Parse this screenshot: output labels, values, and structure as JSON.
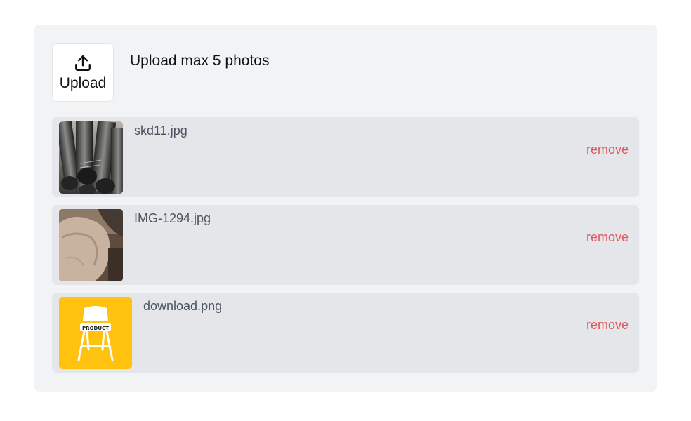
{
  "uploader": {
    "button_label": "Upload",
    "hint": "Upload max 5 photos"
  },
  "files": [
    {
      "name": "skd11.jpg",
      "remove_label": "remove"
    },
    {
      "name": "IMG-1294.jpg",
      "remove_label": "remove"
    },
    {
      "name": "download.png",
      "remove_label": "remove",
      "thumb_text": "PRODUCT",
      "thumb_color": "#ffc20e"
    }
  ],
  "colors": {
    "panel": "#f2f3f5",
    "item": "#e5e6ea",
    "remove": "#e0585f"
  }
}
